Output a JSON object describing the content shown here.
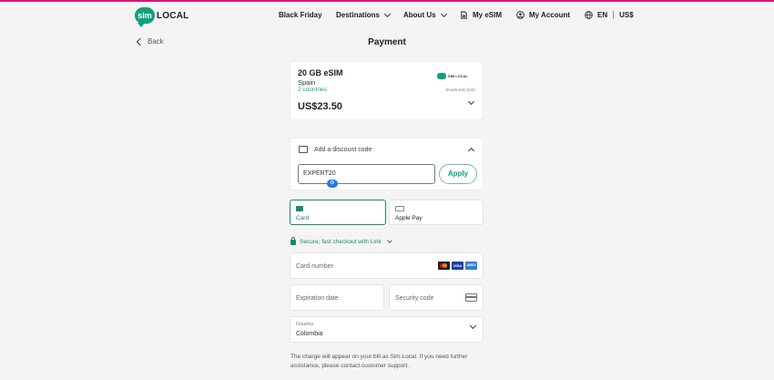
{
  "brand": {
    "logo_mark": "sim",
    "logo_text": "LOCAL",
    "accent": "#14a07c"
  },
  "nav": {
    "black_friday": "Black Friday",
    "destinations": "Destinations",
    "about_us": "About Us",
    "my_esim": "My eSIM",
    "my_account": "My Account",
    "language": "EN",
    "currency": "US$"
  },
  "back_label": "Back",
  "page_title": "Payment",
  "summary": {
    "plan_name": "20 GB eSIM",
    "country": "Spain",
    "countries_link": "2 countries",
    "price": "US$23.50",
    "provider_logo": "SIM LOCAL",
    "note": "Smartroam (UK)"
  },
  "discount": {
    "label": "Add a discount code",
    "code_value": "EXPERT20",
    "apply_label": "Apply"
  },
  "payment_methods": [
    {
      "label": "Card",
      "icon": "card-icon",
      "selected": true
    },
    {
      "label": "Apple Pay",
      "icon": "apple-pay-icon",
      "selected": false
    }
  ],
  "link_checkout": "Secure, fast checkout with Link",
  "card_form": {
    "card_number_placeholder": "Card number",
    "brands": [
      "mastercard",
      "VISA",
      "AMEX"
    ],
    "expiration_placeholder": "Expiration date",
    "security_placeholder": "Security code",
    "country_label": "Country",
    "country_value": "Colombia"
  },
  "footnote": "The charge will appear on your bill as Sim Local. If you need further assistance, please contact customer support."
}
